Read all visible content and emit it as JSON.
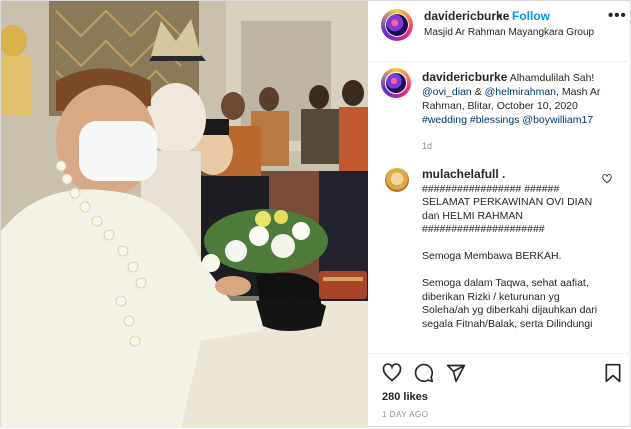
{
  "post": {
    "username": "davidericburke",
    "follow_label": "Follow",
    "separator": "•",
    "location": "Masjid Ar Rahman Mayangkara Group",
    "more_label": "•••"
  },
  "caption": {
    "username": "davidericburke",
    "text_1": "Alhamdulilah Sah!",
    "mention_1": "@ovi_dian",
    "text_2": "&",
    "mention_2": "@helmirahman",
    "text_3": ", Mash Ar Rahman, Blitar, October 10, 2020",
    "tag_1": "#wedding",
    "tag_2": "#blessings",
    "tag_3": "@boywilliam17",
    "time": "1d"
  },
  "comment": {
    "username": "mulachelafull .",
    "text": "################# ######\nSELAMAT PERKAWINAN OVI DIAN dan HELMI RAHMAN\n#####################\n\nSemoga Membawa BERKAH.\n\nSemoga dalam Taqwa, sehat aafiat, diberikan Rizki / keturunan yg Soleha/ah yg diberkahi dijauhkan dari segala Fitnah/Balak, serta Dilindungi"
  },
  "actions": {
    "icons": [
      "heart-icon",
      "comment-icon",
      "share-icon",
      "bookmark-icon"
    ],
    "likes": "280 likes",
    "posted": "1 DAY AGO"
  }
}
